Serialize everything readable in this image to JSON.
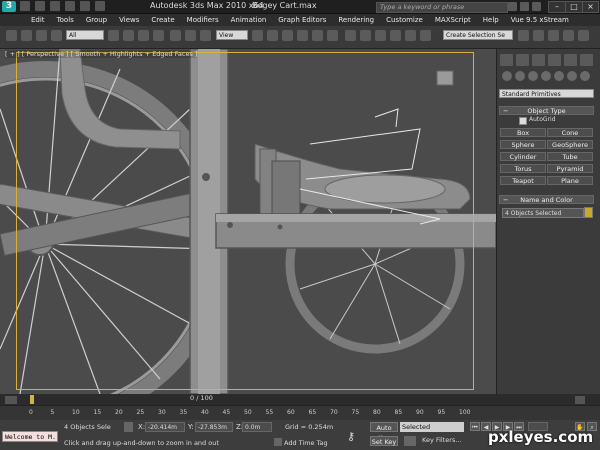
{
  "title_bar": {
    "app_title": "Autodesk 3ds Max  2010 x64",
    "file_name": "Bogey Cart.max",
    "search_placeholder": "Type a keyword or phrase"
  },
  "menu": [
    "Edit",
    "Tools",
    "Group",
    "Views",
    "Create",
    "Modifiers",
    "Animation",
    "Graph Editors",
    "Rendering",
    "Customize",
    "MAXScript",
    "Help",
    "Vue 9.5 xStream"
  ],
  "toolbar": {
    "selection_filter": "All",
    "reference_coord": "View",
    "named_selection_set": "Create Selection Se"
  },
  "viewport": {
    "label": "[ + ] [ Perspective ] [ Smooth + Highlights + Edged Faces ]"
  },
  "command_panel": {
    "primitive_type": "Standard Primitives",
    "object_type_title": "Object Type",
    "autogrid_label": "AutoGrid",
    "primitives": [
      "Box",
      "Cone",
      "Sphere",
      "GeoSphere",
      "Cylinder",
      "Tube",
      "Torus",
      "Pyramid",
      "Teapot",
      "Plane"
    ],
    "name_color_title": "Name and Color",
    "name_value": "4 Objects Selected",
    "object_color": "#c9a82a"
  },
  "timeline": {
    "frame_counter": "0 / 100",
    "ticks": [
      "0",
      "5",
      "10",
      "15",
      "20",
      "25",
      "30",
      "35",
      "40",
      "45",
      "50",
      "55",
      "60",
      "65",
      "70",
      "75",
      "80",
      "85",
      "90",
      "95",
      "100"
    ]
  },
  "status": {
    "maxscript_text": "Welcome to M.",
    "selection_count": "4 Objects Sele",
    "prompt": "Click and drag up-and-down to zoom in and out",
    "x_label": "X:",
    "x_value": "-20.414m",
    "y_label": "Y:",
    "y_value": "-27.853m",
    "z_label": "Z:",
    "z_value": "0.0m",
    "grid": "Grid = 0.254m",
    "add_time_tag": "Add Time Tag",
    "auto_key": "Auto Key",
    "set_key": "Set Key",
    "key_mode": "Selected",
    "key_filters": "Key Filters...",
    "watermark": "pxleyes.com"
  },
  "colors": {
    "viewport_border": "#d6b23a",
    "background": "#3a3a3a"
  }
}
